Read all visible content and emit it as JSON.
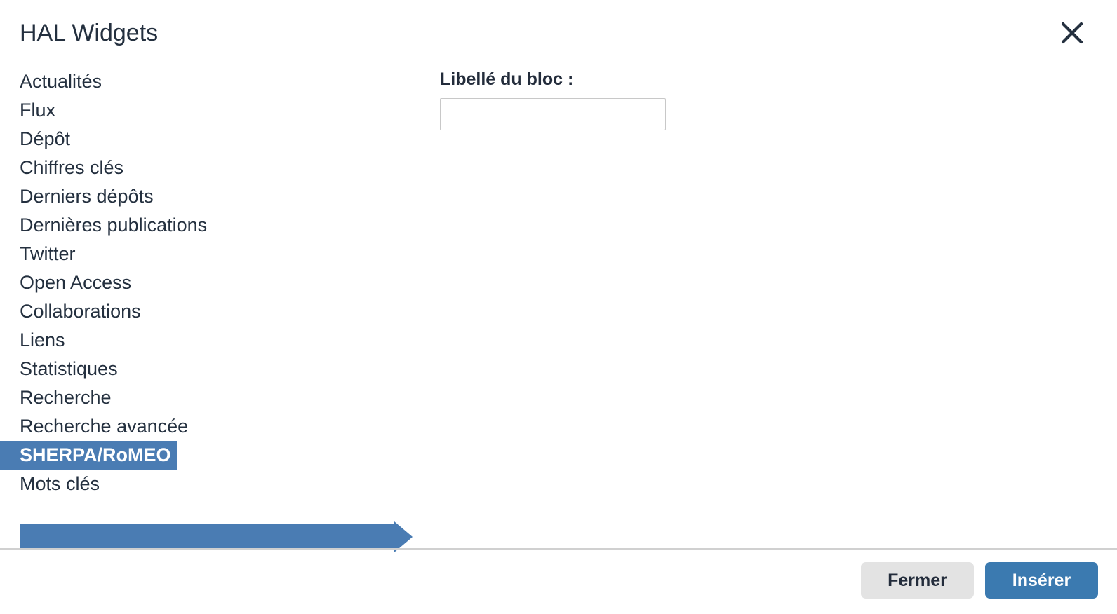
{
  "dialog": {
    "title": "HAL Widgets",
    "close_icon": "close-icon",
    "close_label": "×"
  },
  "widgets": {
    "items": [
      {
        "label": "Actualités",
        "selected": false
      },
      {
        "label": "Flux",
        "selected": false
      },
      {
        "label": "Dépôt",
        "selected": false
      },
      {
        "label": "Chiffres clés",
        "selected": false
      },
      {
        "label": "Derniers dépôts",
        "selected": false
      },
      {
        "label": "Dernières publications",
        "selected": false
      },
      {
        "label": "Twitter",
        "selected": false
      },
      {
        "label": "Open Access",
        "selected": false
      },
      {
        "label": "Collaborations",
        "selected": false
      },
      {
        "label": "Liens",
        "selected": false
      },
      {
        "label": "Statistiques",
        "selected": false
      },
      {
        "label": "Recherche",
        "selected": false
      },
      {
        "label": "Recherche avancée",
        "selected": false
      },
      {
        "label": "SHERPA/RoMEO",
        "selected": true
      },
      {
        "label": "Mots clés",
        "selected": false
      }
    ]
  },
  "form": {
    "block_label_title": "Libellé du bloc :",
    "block_label_value": "",
    "block_label_placeholder": ""
  },
  "annotation": {
    "type": "arrow",
    "direction": "right",
    "points_to": "SHERPA/RoMEO",
    "color": "#4a7cb3"
  },
  "footer": {
    "close_button": "Fermer",
    "insert_button": "Insérer"
  },
  "colors": {
    "accent_blue": "#3b7ab0",
    "selection_blue": "#4a7cb3",
    "text_dark": "#232c3b",
    "button_grey": "#e3e3e3",
    "border_grey": "#c8c8c8",
    "divider_grey": "#d0d0d0"
  }
}
